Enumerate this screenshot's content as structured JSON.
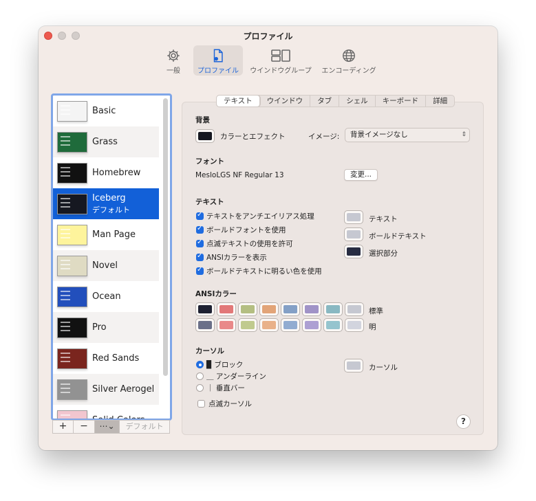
{
  "window": {
    "title": "プロファイル"
  },
  "toolbar": {
    "items": [
      {
        "label": "一般",
        "icon": "gear-icon"
      },
      {
        "label": "プロファイル",
        "icon": "profile-document-icon"
      },
      {
        "label": "ウインドウグループ",
        "icon": "window-group-icon"
      },
      {
        "label": "エンコーディング",
        "icon": "globe-icon"
      }
    ],
    "active_index": 1
  },
  "profiles": {
    "items": [
      {
        "name": "Basic",
        "thumb": "#f4f4f4"
      },
      {
        "name": "Grass",
        "thumb": "#1f6b3b"
      },
      {
        "name": "Homebrew",
        "thumb": "#111111"
      },
      {
        "name": "Iceberg",
        "sub": "デフォルト",
        "thumb": "#161821"
      },
      {
        "name": "Man Page",
        "thumb": "#fef49c"
      },
      {
        "name": "Novel",
        "thumb": "#dfdbc3"
      },
      {
        "name": "Ocean",
        "thumb": "#224fbc"
      },
      {
        "name": "Pro",
        "thumb": "#111111"
      },
      {
        "name": "Red Sands",
        "thumb": "#7a251e"
      },
      {
        "name": "Silver Aerogel",
        "thumb": "#929292"
      },
      {
        "name": "Solid Colors",
        "thumb": "#f2c6cf"
      }
    ],
    "selected_index": 3,
    "buttons": {
      "add": "+",
      "remove": "−",
      "menu": "⋯⌄",
      "default": "デフォルト"
    }
  },
  "tabs": [
    "テキスト",
    "ウインドウ",
    "タブ",
    "シェル",
    "キーボード",
    "詳細"
  ],
  "active_tab": 0,
  "background": {
    "heading": "背景",
    "color_effect_label": "カラーとエフェクト",
    "color": "#161821",
    "image_label": "イメージ:",
    "image_value": "背景イメージなし"
  },
  "font": {
    "heading": "フォント",
    "value": "MesloLGS NF Regular 13",
    "change_button": "変更..."
  },
  "text": {
    "heading": "テキスト",
    "options": [
      {
        "label": "テキストをアンチエイリアス処理",
        "checked": true
      },
      {
        "label": "ボールドフォントを使用",
        "checked": true
      },
      {
        "label": "点滅テキストの使用を許可",
        "checked": true
      },
      {
        "label": "ANSIカラーを表示",
        "checked": true
      },
      {
        "label": "ボールドテキストに明るい色を使用",
        "checked": true
      }
    ],
    "colors": [
      {
        "label": "テキスト",
        "color": "#c6c8d1"
      },
      {
        "label": "ボールドテキスト",
        "color": "#c6c8d1"
      },
      {
        "label": "選択部分",
        "color": "#272c42"
      }
    ]
  },
  "ansi": {
    "heading": "ANSIカラー",
    "normal_label": "標準",
    "bright_label": "明",
    "normal": [
      "#1e2132",
      "#e27878",
      "#b4be82",
      "#e2a478",
      "#84a0c6",
      "#a093c7",
      "#89b8c2",
      "#c6c8d1"
    ],
    "bright": [
      "#6b7089",
      "#e98989",
      "#c0ca8e",
      "#e9b189",
      "#91acd1",
      "#ada0d3",
      "#95c4ce",
      "#d2d4de"
    ]
  },
  "cursor": {
    "heading": "カーソル",
    "styles": [
      {
        "label": "▉ ブロック",
        "selected": true
      },
      {
        "label": "＿ アンダーライン",
        "selected": false
      },
      {
        "label": "｜ 垂直バー",
        "selected": false
      }
    ],
    "blink_label": "点滅カーソル",
    "blink_checked": false,
    "color_label": "カーソル",
    "color": "#c6c8d1"
  },
  "help": "?"
}
